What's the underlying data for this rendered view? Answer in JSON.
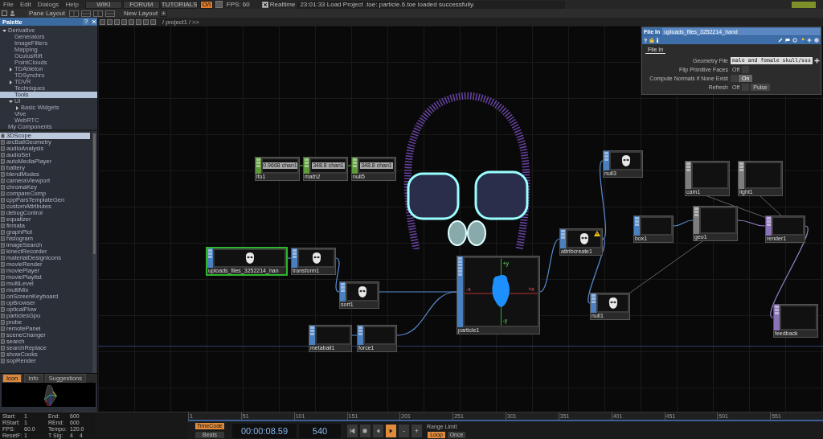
{
  "menu": [
    "File",
    "Edit",
    "Dialogs",
    "Help"
  ],
  "toolbar": {
    "links": [
      "WIKI",
      "FORUM",
      "TUTORIALS"
    ],
    "perform": {
      "label": "O/I",
      "on": true
    },
    "fps": "FPS:  60",
    "realtime": {
      "label": "Realtime",
      "checked": true
    },
    "message": "23:01:33 Load Project .toe: particle.6.toe loaded successfully."
  },
  "layout_bar": {
    "pane_layout": "Pane Layout",
    "new_layout": "New Layout",
    "add": "+"
  },
  "palette": {
    "title": "Palette",
    "help": "?",
    "tree": [
      {
        "label": "Derivative",
        "expanded": true,
        "selected": false,
        "children": [
          {
            "label": "Generators",
            "selected": false
          },
          {
            "label": "ImageFilters",
            "selected": false
          },
          {
            "label": "Mapping",
            "selected": false
          },
          {
            "label": "OculusRift",
            "selected": false
          },
          {
            "label": "PointClouds",
            "selected": false
          },
          {
            "label": "TDAbleton",
            "expanded": false,
            "selected": false
          },
          {
            "label": "TDSynchro",
            "selected": false
          },
          {
            "label": "TDVR",
            "expanded": false,
            "selected": false
          },
          {
            "label": "Techniques",
            "selected": false
          },
          {
            "label": "Tools",
            "selected": true
          },
          {
            "label": "UI",
            "expanded": true,
            "selected": false,
            "children": [
              {
                "label": "Basic Widgets",
                "expanded": false,
                "selected": false
              }
            ]
          },
          {
            "label": "Vive",
            "selected": false
          },
          {
            "label": "WebRTC",
            "selected": false
          }
        ]
      },
      {
        "label": "My Components",
        "selected": false
      }
    ],
    "components": [
      {
        "label": "3DScope",
        "selected": true
      },
      {
        "label": "arcBallGeometry",
        "selected": false
      },
      {
        "label": "audioAnalysis",
        "selected": false
      },
      {
        "label": "audioSet",
        "selected": false
      },
      {
        "label": "autoMediaPlayer",
        "selected": false
      },
      {
        "label": "battery",
        "selected": false
      },
      {
        "label": "blendModes",
        "selected": false
      },
      {
        "label": "cameraViewport",
        "selected": false
      },
      {
        "label": "chromaKey",
        "selected": false
      },
      {
        "label": "compareComp",
        "selected": false
      },
      {
        "label": "cppParsTemplateGen",
        "selected": false
      },
      {
        "label": "customAttributes",
        "selected": false
      },
      {
        "label": "debugControl",
        "selected": false
      },
      {
        "label": "equalizer",
        "selected": false
      },
      {
        "label": "firmata",
        "selected": false
      },
      {
        "label": "graphPlot",
        "selected": false
      },
      {
        "label": "histogram",
        "selected": false
      },
      {
        "label": "imageSearch",
        "selected": false
      },
      {
        "label": "kinectRecorder",
        "selected": false
      },
      {
        "label": "materialDesignIcons",
        "selected": false
      },
      {
        "label": "movieRender",
        "selected": false
      },
      {
        "label": "moviePlayer",
        "selected": false
      },
      {
        "label": "moviePlaylist",
        "selected": false
      },
      {
        "label": "multiLevel",
        "selected": false
      },
      {
        "label": "multiMix",
        "selected": false
      },
      {
        "label": "onScreenKeyboard",
        "selected": false
      },
      {
        "label": "opBrowser",
        "selected": false
      },
      {
        "label": "opticalFlow",
        "selected": false
      },
      {
        "label": "particlesGpu",
        "selected": false
      },
      {
        "label": "probe",
        "selected": false
      },
      {
        "label": "remotePanel",
        "selected": false
      },
      {
        "label": "sceneChanger",
        "selected": false
      },
      {
        "label": "search",
        "selected": false
      },
      {
        "label": "searchReplace",
        "selected": false
      },
      {
        "label": "showCooks",
        "selected": false
      },
      {
        "label": "sopRender",
        "selected": false
      }
    ],
    "preview_tabs": [
      {
        "label": "Icon",
        "selected": true
      },
      {
        "label": "Info",
        "selected": false
      },
      {
        "label": "Suggestions",
        "selected": false
      }
    ]
  },
  "network": {
    "path": "/ project1 / >>",
    "nodes": [
      {
        "label": "lfo1",
        "kind": "chop",
        "selected": false,
        "warning": false,
        "value": "0.9668 chan1"
      },
      {
        "label": "math2",
        "kind": "chop",
        "selected": false,
        "warning": false,
        "value": "348.8 chan1"
      },
      {
        "label": "null5",
        "kind": "chop",
        "selected": false,
        "warning": false,
        "value": "348.8 chan1"
      },
      {
        "label": "null3",
        "kind": "sop",
        "selected": false,
        "warning": false
      },
      {
        "label": "cam1",
        "kind": "comp",
        "selected": false,
        "warning": false
      },
      {
        "label": "light1",
        "kind": "comp",
        "selected": false,
        "warning": false
      },
      {
        "label": "box1",
        "kind": "sop",
        "selected": false,
        "warning": false
      },
      {
        "label": "geo1",
        "kind": "comp",
        "selected": false,
        "warning": false
      },
      {
        "label": "render1",
        "kind": "top",
        "selected": false,
        "warning": false
      },
      {
        "label": "attribcreate1",
        "kind": "sop",
        "selected": false,
        "warning": true
      },
      {
        "label": "uploads_files_3252214_han",
        "kind": "sop",
        "selected": true,
        "warning": false
      },
      {
        "label": "transform1",
        "kind": "sop",
        "selected": false,
        "warning": false
      },
      {
        "label": "sort1",
        "kind": "sop",
        "selected": false,
        "warning": false
      },
      {
        "label": "particle1",
        "kind": "sop",
        "selected": false,
        "warning": false,
        "axes": [
          "+y",
          "-x",
          "+x",
          "-y"
        ]
      },
      {
        "label": "null1",
        "kind": "sop",
        "selected": false,
        "warning": false
      },
      {
        "label": "feedback",
        "kind": "top",
        "selected": false,
        "warning": false
      },
      {
        "label": "metaball1",
        "kind": "sop",
        "selected": false,
        "warning": false
      },
      {
        "label": "force1",
        "kind": "sop",
        "selected": false,
        "warning": false
      }
    ]
  },
  "parameters": {
    "type": "File In",
    "name": "uploads_files_3252214_hand",
    "help": "?",
    "tabs": [
      {
        "label": "File In",
        "selected": true
      }
    ],
    "params": [
      {
        "label": "Geometry File",
        "kind": "file",
        "value": "male and female skull/sss"
      },
      {
        "label": "Flip Primitive Faces",
        "kind": "toggle",
        "on": false,
        "text": "Off"
      },
      {
        "label": "Compute Normals if None Exist",
        "kind": "toggle",
        "on": true,
        "text": "On"
      },
      {
        "label": "Refresh",
        "kind": "pulse",
        "on": false,
        "text": "Off",
        "button": "Pulse"
      }
    ]
  },
  "timeline": {
    "info": [
      {
        "label": "Start:",
        "values": [
          "1"
        ]
      },
      {
        "label": "End:",
        "values": [
          "600"
        ]
      },
      {
        "label": "RStart:",
        "values": [
          "1"
        ]
      },
      {
        "label": "REnd:",
        "values": [
          "600"
        ]
      },
      {
        "label": "FPS:",
        "values": [
          "60.0"
        ]
      },
      {
        "label": "Tempo:",
        "values": [
          "120.0"
        ]
      },
      {
        "label": "ResetF:",
        "values": [
          "1"
        ]
      },
      {
        "label": "T Sig:",
        "values": [
          "4",
          "4"
        ]
      }
    ],
    "ruler": [
      "1",
      "51",
      "101",
      "151",
      "201",
      "251",
      "301",
      "351",
      "401",
      "451",
      "501",
      "551"
    ],
    "modes": [
      {
        "label": "TimeCode",
        "selected": true
      },
      {
        "label": "Beats",
        "selected": false
      }
    ],
    "timecode": "00:00:08.59",
    "frame": "540",
    "transport": [
      {
        "kind": "rewind",
        "selected": false
      },
      {
        "kind": "stop",
        "selected": false
      },
      {
        "kind": "reverse",
        "selected": false
      },
      {
        "kind": "play",
        "selected": true
      },
      {
        "kind": "step",
        "label": "-",
        "selected": false
      },
      {
        "kind": "step",
        "label": "+",
        "selected": false
      }
    ],
    "range_label": "Range Limit",
    "range_modes": [
      {
        "label": "Loop",
        "selected": true
      },
      {
        "label": "Once",
        "selected": false
      }
    ]
  }
}
